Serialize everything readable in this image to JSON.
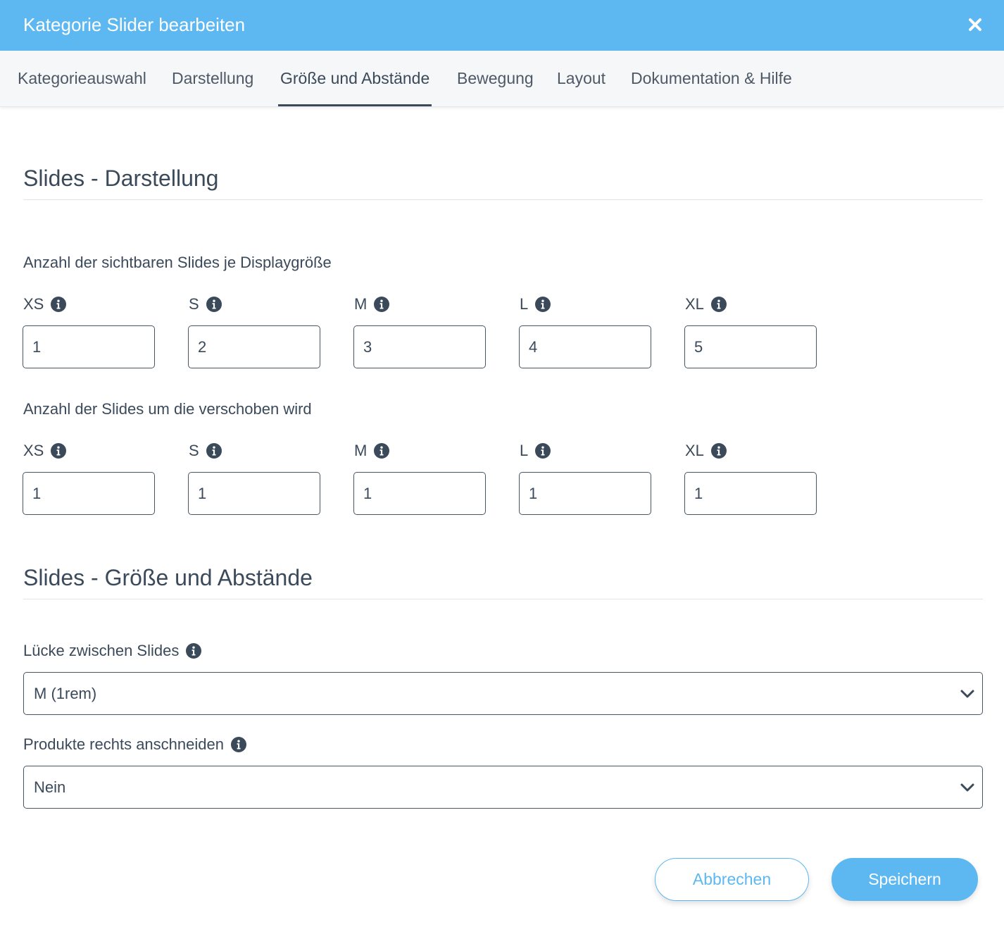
{
  "dialog": {
    "title": "Kategorie Slider bearbeiten",
    "close_icon": "close-icon"
  },
  "tabs": [
    {
      "label": "Kategorieauswahl",
      "active": false
    },
    {
      "label": "Darstellung",
      "active": false
    },
    {
      "label": "Größe und Abstände",
      "active": true
    },
    {
      "label": "Bewegung",
      "active": false
    },
    {
      "label": "Layout",
      "active": false
    },
    {
      "label": "Dokumentation & Hilfe",
      "active": false
    }
  ],
  "section1": {
    "title": "Slides - Darstellung",
    "visible_group": {
      "label": "Anzahl der sichtbaren Slides je Displaygröße",
      "fields": [
        {
          "label": "XS",
          "value": "1"
        },
        {
          "label": "S",
          "value": "2"
        },
        {
          "label": "M",
          "value": "3"
        },
        {
          "label": "L",
          "value": "4"
        },
        {
          "label": "XL",
          "value": "5"
        }
      ]
    },
    "scroll_group": {
      "label": "Anzahl der Slides um die verschoben wird",
      "fields": [
        {
          "label": "XS",
          "value": "1"
        },
        {
          "label": "S",
          "value": "1"
        },
        {
          "label": "M",
          "value": "1"
        },
        {
          "label": "L",
          "value": "1"
        },
        {
          "label": "XL",
          "value": "1"
        }
      ]
    }
  },
  "section2": {
    "title": "Slides - Größe und Abstände",
    "gap": {
      "label": "Lücke zwischen Slides",
      "value": "M (1rem)"
    },
    "crop": {
      "label": "Produkte rechts anschneiden",
      "value": "Nein"
    }
  },
  "footer": {
    "cancel_label": "Abbrechen",
    "save_label": "Speichern"
  },
  "colors": {
    "accent": "#5db8f2",
    "text": "#3b4a5a",
    "border": "#4a5563"
  }
}
